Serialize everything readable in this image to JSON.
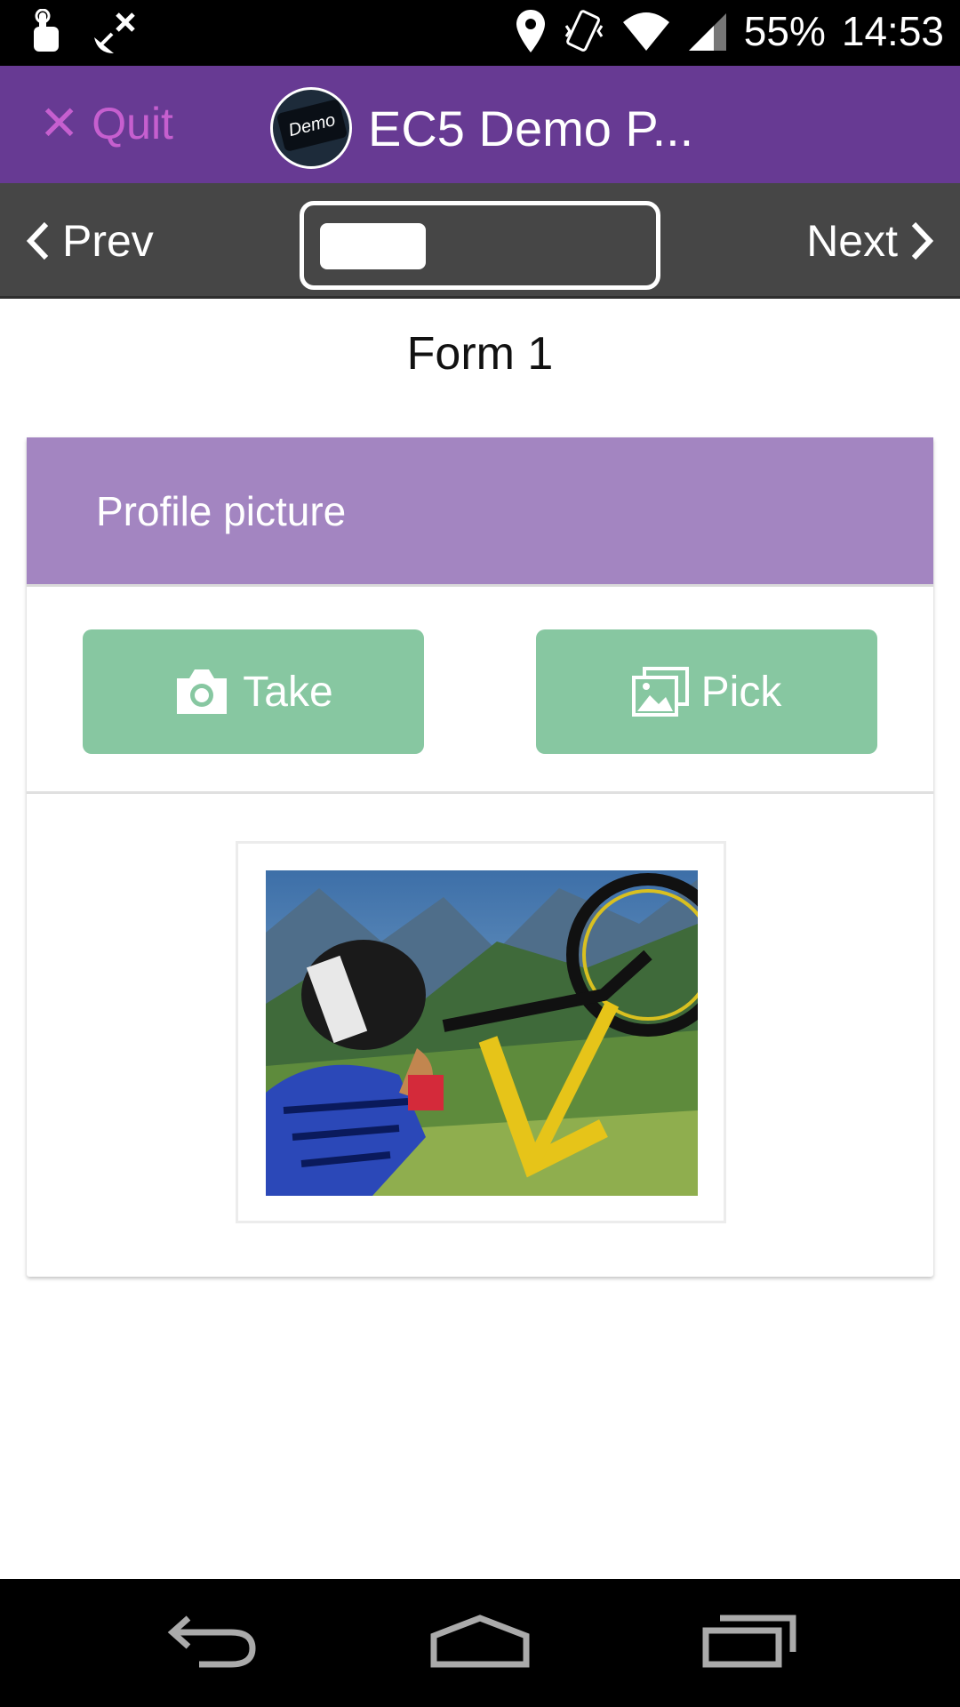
{
  "status_bar": {
    "battery": "55%",
    "time": "14:53",
    "icons": [
      "touch-icon",
      "satellite-off-icon",
      "location-icon",
      "vibrate-icon",
      "wifi-icon",
      "signal-icon"
    ]
  },
  "app_bar": {
    "quit_label": "Quit",
    "project_title": "EC5 Demo P...",
    "logo_text": "Demo"
  },
  "nav": {
    "prev_label": "Prev",
    "next_label": "Next",
    "progress": 0.33
  },
  "form": {
    "title": "Form 1",
    "question_label": "Profile picture",
    "take_label": "Take",
    "pick_label": "Pick"
  },
  "colors": {
    "app_bar": "#673a93",
    "quit": "#c65fcf",
    "card_header": "#a385c1",
    "button": "#87c7a1",
    "nav_bar": "#464646"
  }
}
